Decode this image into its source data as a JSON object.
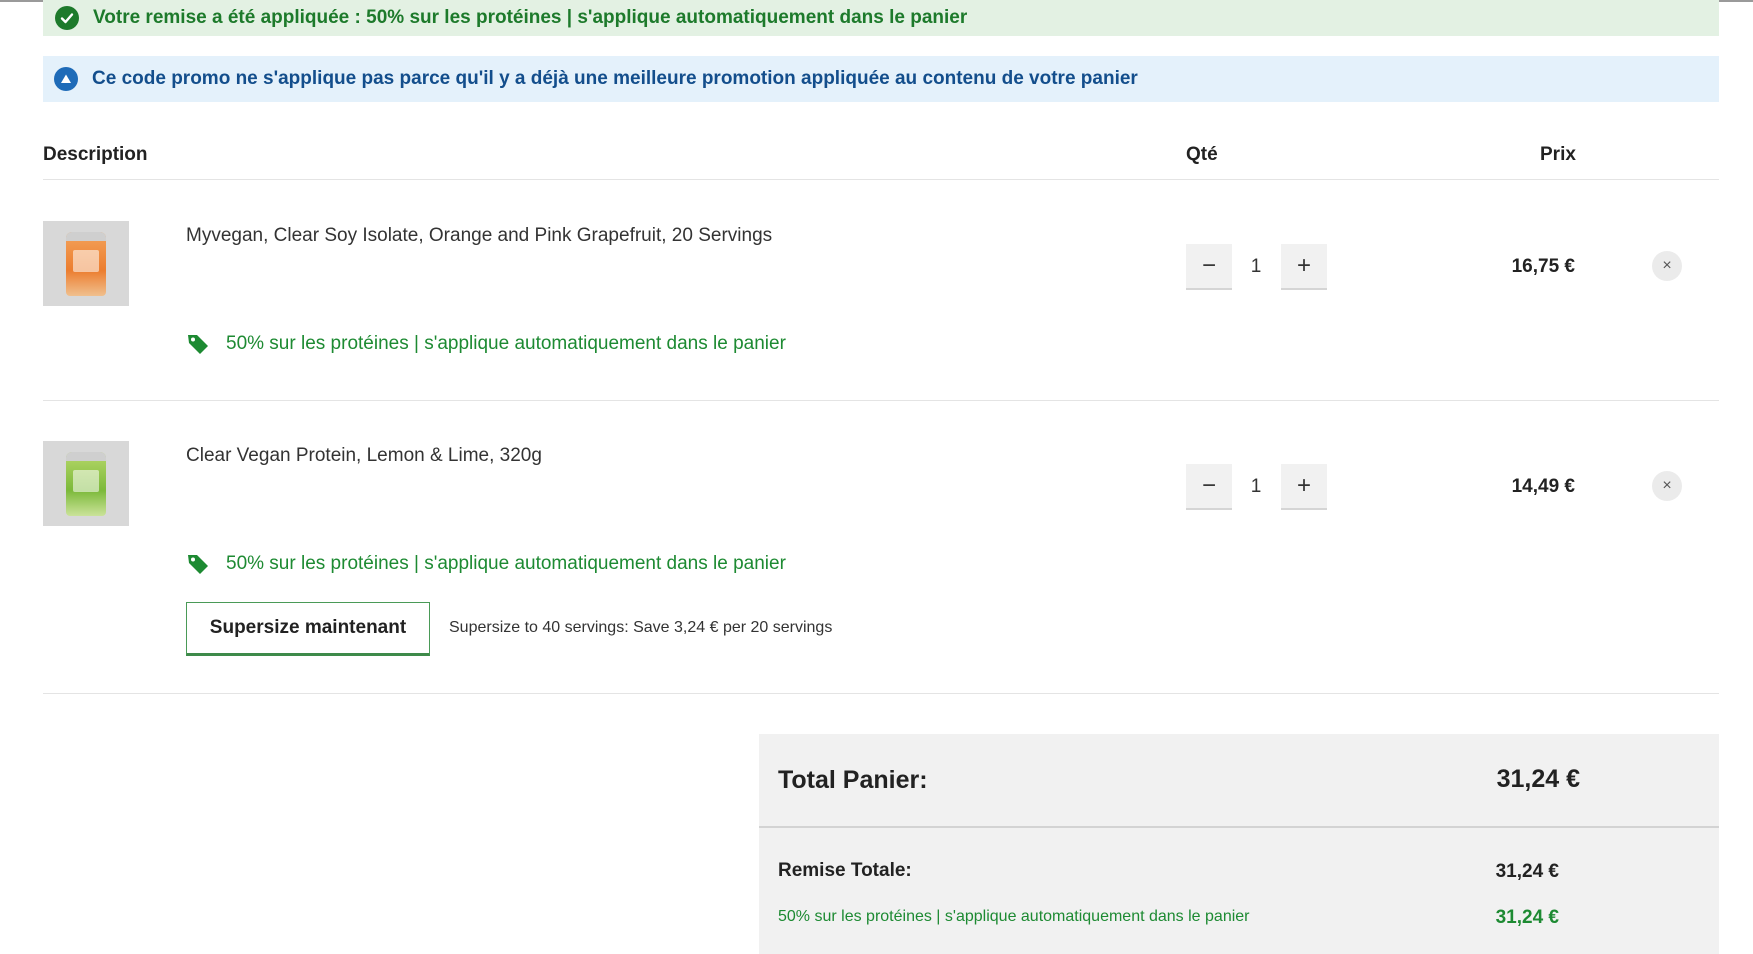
{
  "banners": {
    "success": "Votre remise a été appliquée : 50% sur les protéines | s'applique automatiquement dans le panier",
    "info": "Ce code promo ne s'applique pas parce qu'il y a déjà une meilleure promotion appliquée au contenu de votre panier"
  },
  "table": {
    "headers": {
      "description": "Description",
      "qty": "Qté",
      "price": "Prix"
    }
  },
  "items": [
    {
      "name": "Myvegan, Clear Soy Isolate, Orange and Pink Grapefruit, 20 Servings",
      "promo": "50% sur les protéines | s'applique automatiquement dans le panier",
      "qty": "1",
      "price": "16,75 €",
      "minus": "−",
      "plus": "+",
      "remove": "×"
    },
    {
      "name": "Clear Vegan Protein, Lemon & Lime, 320g",
      "promo": "50% sur les protéines | s'applique automatiquement dans le panier",
      "qty": "1",
      "price": "14,49 €",
      "minus": "−",
      "plus": "+",
      "remove": "×",
      "supersize_button": "Supersize maintenant",
      "supersize_text": "Supersize to 40 servings: Save 3,24 € per 20 servings"
    }
  ],
  "summary": {
    "total_label": "Total Panier:",
    "total_value": "31,24 €",
    "discount_label": "Remise Totale:",
    "discount_value": "31,24 €",
    "promo_label": "50% sur les protéines | s'applique automatiquement dans le panier",
    "promo_value": "31,24 €"
  },
  "colors": {
    "success_green": "#1d7a2b",
    "promo_green": "#1d8a32",
    "info_blue": "#134e8c"
  },
  "icons": {
    "success": "check-circle-icon",
    "info": "alert-triangle-circle-icon",
    "promo": "price-tag-icon",
    "remove": "close-icon"
  }
}
